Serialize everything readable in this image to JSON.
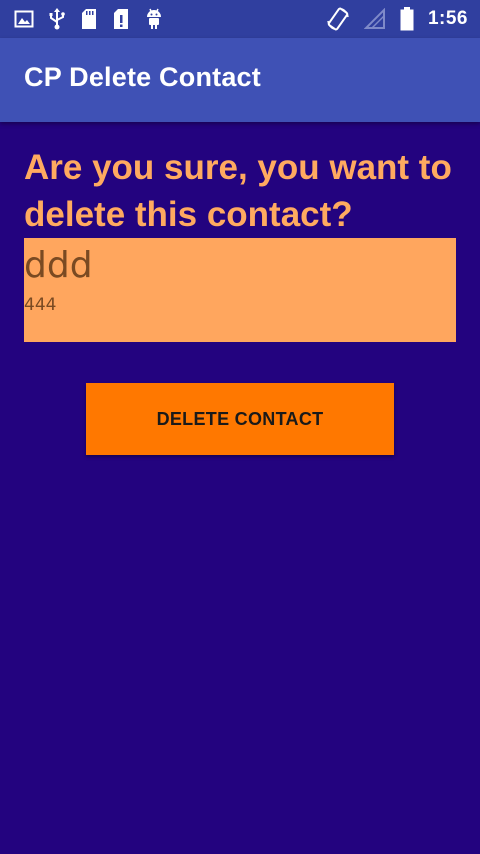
{
  "status_bar": {
    "time": "1:56",
    "left_icons": [
      "image-icon",
      "usb-icon",
      "sd-card-icon",
      "sd-card-alert-icon",
      "android-icon"
    ],
    "right_icons": [
      "screen-rotation-icon",
      "no-signal-icon",
      "battery-icon"
    ]
  },
  "app_bar": {
    "title": "CP Delete Contact"
  },
  "main": {
    "question": "Are you sure, you want to delete this contact?",
    "contact": {
      "name": "ddd",
      "phone": "444"
    },
    "delete_button_label": "DELETE CONTACT"
  },
  "colors": {
    "background": "#23037f",
    "status_bar": "#303f9f",
    "app_bar": "#3f51b5",
    "question_text": "#ffaa60",
    "card": "#ffa65e",
    "card_text": "#7a4a22",
    "button": "#ff7800"
  }
}
